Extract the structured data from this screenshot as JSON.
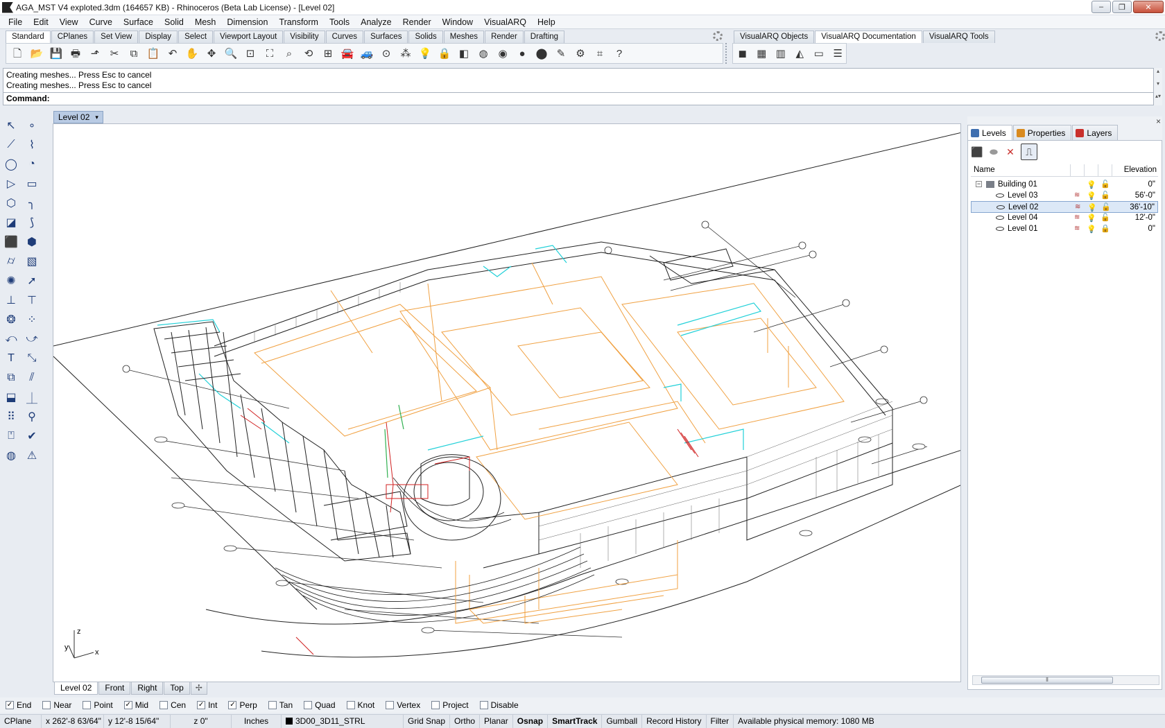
{
  "window": {
    "title": "AGA_MST V4 exploted.3dm (164657 KB) - Rhinoceros (Beta Lab License) - [Level 02]",
    "controls": [
      "–",
      "❐",
      "✕"
    ]
  },
  "menubar": [
    "File",
    "Edit",
    "View",
    "Curve",
    "Surface",
    "Solid",
    "Mesh",
    "Dimension",
    "Transform",
    "Tools",
    "Analyze",
    "Render",
    "Window",
    "VisualARQ",
    "Help"
  ],
  "toolbar_tabs_left": [
    "Standard",
    "CPlanes",
    "Set View",
    "Display",
    "Select",
    "Viewport Layout",
    "Visibility",
    "Curves",
    "Surfaces",
    "Solids",
    "Meshes",
    "Render",
    "Drafting"
  ],
  "toolbar_tabs_right": [
    "VisualARQ Objects",
    "VisualARQ Documentation",
    "VisualARQ Tools"
  ],
  "toolbar_icons_left": [
    {
      "name": "new-file-icon",
      "glyph": "🗋"
    },
    {
      "name": "open-file-icon",
      "glyph": "📂"
    },
    {
      "name": "save-icon",
      "glyph": "💾"
    },
    {
      "name": "print-icon",
      "glyph": "🖶"
    },
    {
      "name": "export-icon",
      "glyph": "⬏"
    },
    {
      "name": "cut-icon",
      "glyph": "✂"
    },
    {
      "name": "copy-icon",
      "glyph": "⧉"
    },
    {
      "name": "paste-icon",
      "glyph": "📋"
    },
    {
      "name": "undo-icon",
      "glyph": "↶"
    },
    {
      "name": "pan-hand-icon",
      "glyph": "✋"
    },
    {
      "name": "rotate-view-icon",
      "glyph": "✥"
    },
    {
      "name": "zoom-icon",
      "glyph": "🔍"
    },
    {
      "name": "zoom-window-icon",
      "glyph": "⊡"
    },
    {
      "name": "zoom-extents-icon",
      "glyph": "⛶"
    },
    {
      "name": "zoom-selected-icon",
      "glyph": "⌕"
    },
    {
      "name": "rotate-icon",
      "glyph": "⟲"
    },
    {
      "name": "four-views-icon",
      "glyph": "⊞"
    },
    {
      "name": "car-icon",
      "glyph": "🚘"
    },
    {
      "name": "grid-car-icon",
      "glyph": "🚙"
    },
    {
      "name": "sphere-point-icon",
      "glyph": "⊙"
    },
    {
      "name": "select-points-icon",
      "glyph": "⁂"
    },
    {
      "name": "light-bulb-icon",
      "glyph": "💡"
    },
    {
      "name": "lock-icon",
      "glyph": "🔒"
    },
    {
      "name": "layer-color-icon",
      "glyph": "◧"
    },
    {
      "name": "color-wheel-icon",
      "glyph": "◍"
    },
    {
      "name": "shaded-sphere-icon",
      "glyph": "◉"
    },
    {
      "name": "rendered-sphere-icon",
      "glyph": "●"
    },
    {
      "name": "blue-sphere-icon",
      "glyph": "⬤"
    },
    {
      "name": "pen-icon",
      "glyph": "✎"
    },
    {
      "name": "gear-tools-icon",
      "glyph": "⚙"
    },
    {
      "name": "snap-points-icon",
      "glyph": "⌗"
    },
    {
      "name": "help-icon",
      "glyph": "?"
    }
  ],
  "toolbar_icons_right": [
    {
      "name": "vaobject-box-icon",
      "glyph": "◼"
    },
    {
      "name": "table-icon",
      "glyph": "▦"
    },
    {
      "name": "building-icon",
      "glyph": "▥"
    },
    {
      "name": "section-icon",
      "glyph": "◭"
    },
    {
      "name": "elevation-icon",
      "glyph": "▭"
    },
    {
      "name": "levels-stack-icon",
      "glyph": "☰"
    }
  ],
  "command": {
    "history": [
      "Creating meshes... Press Esc to cancel",
      "Creating meshes... Press Esc to cancel"
    ],
    "prompt": "Command:"
  },
  "left_tools": [
    {
      "name": "select-arrow-icon",
      "glyph": "↖"
    },
    {
      "name": "point-icon",
      "glyph": "∘"
    },
    {
      "name": "polyline-icon",
      "glyph": "⟋"
    },
    {
      "name": "control-point-curve-icon",
      "glyph": "⌇"
    },
    {
      "name": "circle-icon",
      "glyph": "◯"
    },
    {
      "name": "arc-center-icon",
      "glyph": "◔"
    },
    {
      "name": "polygon-outline-icon",
      "glyph": "▷"
    },
    {
      "name": "rectangle-icon",
      "glyph": "▭"
    },
    {
      "name": "hexagon-icon",
      "glyph": "⬡"
    },
    {
      "name": "fillet-curve-icon",
      "glyph": "╮"
    },
    {
      "name": "surface-from-points-icon",
      "glyph": "◪"
    },
    {
      "name": "sweep-icon",
      "glyph": "⟆"
    },
    {
      "name": "box-icon",
      "glyph": "⬛"
    },
    {
      "name": "boolean-union-icon",
      "glyph": "⬢"
    },
    {
      "name": "cylinder-icon",
      "glyph": "⌭"
    },
    {
      "name": "mesh-plane-icon",
      "glyph": "▧"
    },
    {
      "name": "gear-explode-icon",
      "glyph": "✺"
    },
    {
      "name": "arrow-move-icon",
      "glyph": "➚"
    },
    {
      "name": "trim-icon",
      "glyph": "⊥"
    },
    {
      "name": "split-icon",
      "glyph": "⊤"
    },
    {
      "name": "group-icon",
      "glyph": "❂"
    },
    {
      "name": "ungroup-icon",
      "glyph": "⁘"
    },
    {
      "name": "rotate-object-icon",
      "glyph": "⤺"
    },
    {
      "name": "scale-object-icon",
      "glyph": "⤻"
    },
    {
      "name": "text-icon",
      "glyph": "T"
    },
    {
      "name": "dimension-icon",
      "glyph": "⤡"
    },
    {
      "name": "block-icon",
      "glyph": "⧉"
    },
    {
      "name": "properties-match-icon",
      "glyph": "⫽"
    },
    {
      "name": "wall-icon",
      "glyph": "⬓"
    },
    {
      "name": "level-icon",
      "glyph": "⏊"
    },
    {
      "name": "array-icon",
      "glyph": "⠿"
    },
    {
      "name": "column-icon",
      "glyph": "⚲"
    },
    {
      "name": "analyze-icon",
      "glyph": "⍞"
    },
    {
      "name": "check-icon",
      "glyph": "✔"
    },
    {
      "name": "render-object-icon",
      "glyph": "◍"
    },
    {
      "name": "material-icon",
      "glyph": "⚠"
    }
  ],
  "viewport": {
    "active_title": "Level 02",
    "dropdown_icon": "▾",
    "axes": {
      "x": "x",
      "y": "y",
      "z": "z"
    }
  },
  "view_tabs": [
    "Level 02",
    "Front",
    "Right",
    "Top"
  ],
  "view_tab_add": "✢",
  "right_panel": {
    "tabs": [
      {
        "label": "Levels",
        "color": "#3f6fb0"
      },
      {
        "label": "Properties",
        "color": "#d98a1e"
      },
      {
        "label": "Layers",
        "color": "#c9302c"
      }
    ],
    "close_glyph": "×",
    "toolbar": [
      {
        "name": "new-building-icon",
        "glyph": "⬛"
      },
      {
        "name": "new-level-icon",
        "glyph": "⬬"
      },
      {
        "name": "delete-icon",
        "glyph": "✕"
      },
      {
        "name": "level-settings-icon",
        "glyph": "⎍"
      }
    ],
    "columns": {
      "name": "Name",
      "elevation": "Elevation"
    },
    "levels": [
      {
        "name": "Building 01",
        "elevation": "0\"",
        "kind": "building",
        "bulb": "💡",
        "lock": "🔓"
      },
      {
        "name": "Level 03",
        "elevation": "56'-0\"",
        "kind": "level",
        "sec": "≋",
        "bulb": "💡",
        "lock": "🔓"
      },
      {
        "name": "Level 02",
        "elevation": "36'-10\"",
        "kind": "level",
        "sec": "≋",
        "bulb": "💡",
        "lock": "🔓",
        "selected": true
      },
      {
        "name": "Level 04",
        "elevation": "12'-0\"",
        "kind": "level",
        "sec": "≋",
        "bulb": "💡",
        "lock": "🔓"
      },
      {
        "name": "Level 01",
        "elevation": "0\"",
        "kind": "level",
        "sec": "≋",
        "bulb": "💡",
        "lock": "🔒"
      }
    ],
    "hscroll_grip": "⦀",
    "expander": "−"
  },
  "osnaps": [
    {
      "label": "End",
      "checked": true
    },
    {
      "label": "Near",
      "checked": false
    },
    {
      "label": "Point",
      "checked": false
    },
    {
      "label": "Mid",
      "checked": true
    },
    {
      "label": "Cen",
      "checked": false
    },
    {
      "label": "Int",
      "checked": true
    },
    {
      "label": "Perp",
      "checked": true
    },
    {
      "label": "Tan",
      "checked": false
    },
    {
      "label": "Quad",
      "checked": false
    },
    {
      "label": "Knot",
      "checked": false
    },
    {
      "label": "Vertex",
      "checked": false
    },
    {
      "label": "Project",
      "checked": false
    },
    {
      "label": "Disable",
      "checked": false
    }
  ],
  "status": {
    "cplane": "CPlane",
    "x": "x 262'-8 63/64\"",
    "y": "y 12'-8 15/64\"",
    "z": "z 0\"",
    "units": "Inches",
    "layer": "3D00_3D11_STRL",
    "buttons": [
      {
        "label": "Grid Snap",
        "bold": false
      },
      {
        "label": "Ortho",
        "bold": false
      },
      {
        "label": "Planar",
        "bold": false
      },
      {
        "label": "Osnap",
        "bold": true
      },
      {
        "label": "SmartTrack",
        "bold": true
      },
      {
        "label": "Gumball",
        "bold": false
      },
      {
        "label": "Record History",
        "bold": false
      },
      {
        "label": "Filter",
        "bold": false
      }
    ],
    "memory": "Available physical memory: 1080 MB"
  },
  "colors": {
    "wire_orange": "#f0a040",
    "wire_cyan": "#20d0d8",
    "wire_black": "#202020",
    "wire_red": "#d02020",
    "wire_green": "#30b050",
    "selection_blue": "#dce8f7"
  }
}
